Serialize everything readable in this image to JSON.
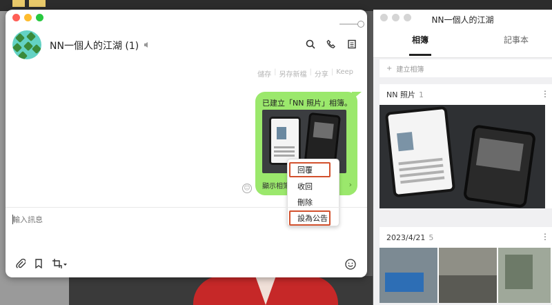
{
  "chat": {
    "title": "NN一個人的江湖 (1)",
    "save_actions": [
      "儲存",
      "另存新檔",
      "分享",
      "Keep"
    ],
    "message": {
      "text": "已建立「NN 照片」相簿。",
      "footer": "顯示相簿"
    },
    "context_menu": {
      "reply": "回覆",
      "unsend": "收回",
      "delete": "刪除",
      "announce": "設為公告"
    },
    "input_placeholder": "輸入訊息"
  },
  "album_window": {
    "title": "NN一個人的江湖",
    "tabs": [
      "相簿",
      "記事本"
    ],
    "create_album": "建立相簿",
    "albums": [
      {
        "name": "NN 照片",
        "count": "1"
      },
      {
        "name": "2023/4/21",
        "count": "5"
      }
    ]
  },
  "colors": {
    "bubble": "#9be86c",
    "highlight_border": "#d2502c",
    "avatar": "#63d2c4"
  }
}
